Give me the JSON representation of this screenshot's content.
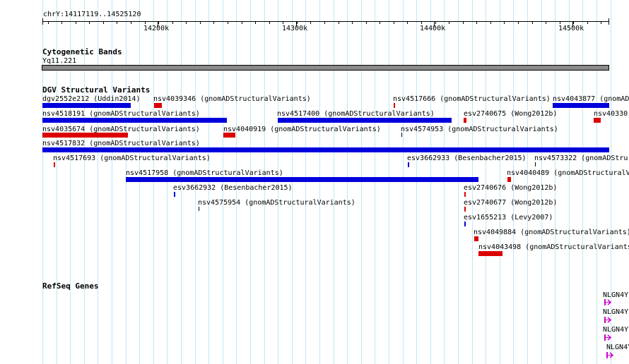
{
  "ruler": {
    "location": "chrY:14117119..14525120",
    "ticks": [
      "14200k",
      "14300k",
      "14400k",
      "14500k"
    ]
  },
  "tracks": {
    "cytoband": {
      "title": "Cytogenetic Bands",
      "band": "Yq11.221"
    },
    "dgv": {
      "title": "DGV Structural Variants"
    },
    "refseq": {
      "title": "RefSeq Genes"
    }
  },
  "variants": [
    {
      "label": "dgv2552e212 (Uddin2014)",
      "color": "#0000dd"
    },
    {
      "label": "nsv4039346 (gnomADStructuralVariants)",
      "color": "#dd0000"
    },
    {
      "label": "nsv4517666 (gnomADStructuralVariants)",
      "color": "#dd0000"
    },
    {
      "label": "nsv4043877 (gnomAD",
      "color": "#0000dd"
    },
    {
      "label": "nsv4518191 (gnomADStructuralVariants)",
      "color": "#0000dd"
    },
    {
      "label": "nsv4517400 (gnomADStructuralVariants)",
      "color": "#0000dd"
    },
    {
      "label": "esv2740675 (Wong2012b)",
      "color": "#dd0000"
    },
    {
      "label": "nsv40330",
      "color": "#dd0000"
    },
    {
      "label": "nsv4035674 (gnomADStructuralVariants)",
      "color": "#dd0000"
    },
    {
      "label": "nsv4040919 (gnomADStructuralVariants)",
      "color": "#dd0000"
    },
    {
      "label": "nsv4574953 (gnomADStructuralVariants)",
      "color": "#000000"
    },
    {
      "label": "nsv4517832 (gnomADStructuralVariants)",
      "color": "#0000dd"
    },
    {
      "label": "nsv4517693 (gnomADStructuralVariants)",
      "color": "#dd0000"
    },
    {
      "label": "esv3662933 (Besenbacher2015)",
      "color": "#0000dd"
    },
    {
      "label": "nsv4573322 (gnomADStru",
      "color": "#000000"
    },
    {
      "label": "nsv4517958 (gnomADStructuralVariants)",
      "color": "#0000dd"
    },
    {
      "label": "nsv4040489 (gnomADStructuralV",
      "color": "#dd0000"
    },
    {
      "label": "esv3662932 (Besenbacher2015)",
      "color": "#0000dd"
    },
    {
      "label": "esv2740676 (Wong2012b)",
      "color": "#dd0000"
    },
    {
      "label": "nsv4575954 (gnomADStructuralVariants)",
      "color": "#000000"
    },
    {
      "label": "esv2740677 (Wong2012b)",
      "color": "#dd0000"
    },
    {
      "label": "esv1655213 (Levy2007)",
      "color": "#0000dd"
    },
    {
      "label": "nsv4049884 (gnomADStructuralVariants)",
      "color": "#dd0000"
    },
    {
      "label": "nsv4043498 (gnomADStructuralVariants",
      "color": "#dd0000"
    }
  ],
  "genes": [
    {
      "label": "NLGN4Y",
      "color": "#cc00cc",
      "icon": "strand-arrow-icon"
    },
    {
      "label": "NLGN4Y",
      "color": "#cc00cc",
      "icon": "strand-arrow-icon"
    },
    {
      "label": "NLGN4Y",
      "color": "#cc00cc",
      "icon": "strand-arrow-icon"
    },
    {
      "label": "NLGN4Y",
      "color": "#cc00cc",
      "icon": "strand-arrow-icon"
    }
  ]
}
